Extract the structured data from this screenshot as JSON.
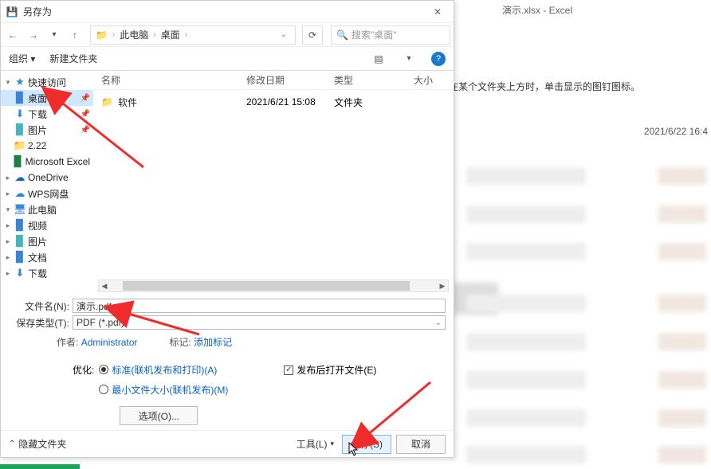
{
  "excelBg": {
    "title": "演示.xlsx - Excel",
    "hint": "在某个文件夹上方时，单击显示的图钉图标。",
    "date": "2021/6/22 16:4"
  },
  "dialog": {
    "title": "另存为",
    "close_glyph": "✕",
    "nav": {
      "back": "←",
      "forward": "→",
      "up": "↑",
      "refresh": "⟳",
      "breadcrumb": {
        "pc": "此电脑",
        "desktop": "桌面"
      },
      "search_placeholder": "搜索\"桌面\""
    },
    "toolbar": {
      "organize": "组织 ▾",
      "new_folder": "新建文件夹",
      "help": "?"
    },
    "sidebar": [
      {
        "arr": "▾",
        "ico": "★",
        "color": "#3a84d6",
        "label": "快速访问",
        "pin": ""
      },
      {
        "arr": "",
        "ico": "▉",
        "color": "#3a84d6",
        "label": "桌面",
        "pin": "📌",
        "selected": true
      },
      {
        "arr": "",
        "ico": "⬇",
        "color": "#3a84d6",
        "label": "下载",
        "pin": "📌"
      },
      {
        "arr": "",
        "ico": "▉",
        "color": "#46b3bd",
        "label": "图片",
        "pin": "📌"
      },
      {
        "arr": "",
        "ico": "📁",
        "color": "#efb85c",
        "label": "2.22",
        "pin": ""
      },
      {
        "arr": "",
        "ico": "▉",
        "color": "#1c7f44",
        "label": "Microsoft Excel",
        "pin": ""
      },
      {
        "arr": "▸",
        "ico": "☁",
        "color": "#0b63c4",
        "label": "OneDrive",
        "pin": ""
      },
      {
        "arr": "▸",
        "ico": "☁",
        "color": "#2a83e0",
        "label": "WPS网盘",
        "pin": ""
      },
      {
        "arr": "▾",
        "ico": "🖥",
        "color": "#3a84d6",
        "label": "此电脑",
        "pin": ""
      },
      {
        "arr": "▸",
        "ico": "▉",
        "color": "#3a84d6",
        "label": "视频",
        "pin": ""
      },
      {
        "arr": "▸",
        "ico": "▉",
        "color": "#46b3bd",
        "label": "图片",
        "pin": ""
      },
      {
        "arr": "▸",
        "ico": "▉",
        "color": "#3a84d6",
        "label": "文档",
        "pin": ""
      },
      {
        "arr": "▸",
        "ico": "⬇",
        "color": "#3a84d6",
        "label": "下载",
        "pin": ""
      }
    ],
    "columns": {
      "name": "名称",
      "modified": "修改日期",
      "type": "类型",
      "size": "大小"
    },
    "files": [
      {
        "name": "软件",
        "modified": "2021/6/21 15:08",
        "type": "文件夹"
      }
    ],
    "form": {
      "filename_label": "文件名(N):",
      "filename_value": "演示.pdf",
      "filetype_label": "保存类型(T):",
      "filetype_value": "PDF (*.pdf)",
      "author_label": "作者:",
      "author_value": "Administrator",
      "tags_label": "标记:",
      "tags_value": "添加标记",
      "optimize_label": "优化:",
      "opt_standard": "标准(联机发布和打印)(A)",
      "opt_min": "最小文件大小(联机发布)(M)",
      "open_after": "发布后打开文件(E)",
      "options_btn": "选项(O)..."
    },
    "footer": {
      "hide_folders": "隐藏文件夹",
      "tools": "工具(L)",
      "save": "保存(S)",
      "cancel": "取消"
    }
  }
}
